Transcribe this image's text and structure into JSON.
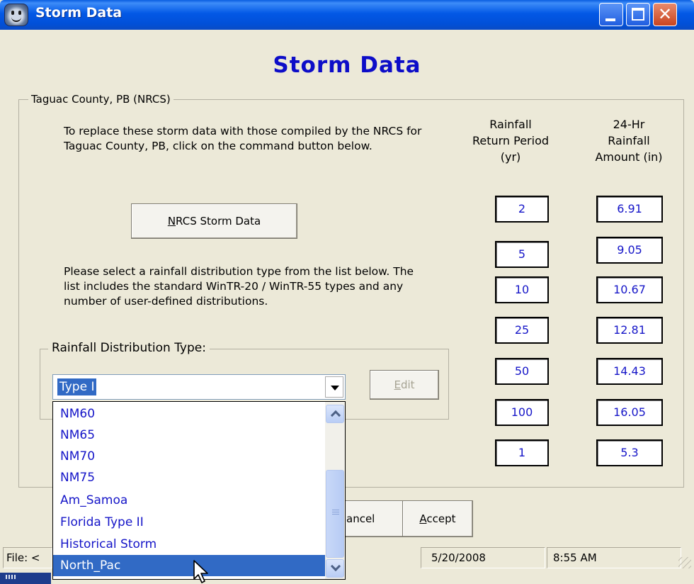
{
  "window": {
    "title": "Storm Data",
    "controls": [
      "minimize",
      "maximize",
      "close"
    ]
  },
  "heading": "Storm Data",
  "county_group": {
    "legend": "Taguac County, PB  (NRCS)",
    "instructions": "To replace these storm data with those compiled by the NRCS for Taguac County, PB, click on the command button below.",
    "nrcs_button": {
      "mnemonic": "N",
      "rest": "RCS Storm Data"
    },
    "distribution_instructions": "Please select a rainfall distribution type from the list below. The list includes the standard WinTR-20 / WinTR-55 types and any number of user-defined distributions."
  },
  "distribution": {
    "legend": "Rainfall Distribution Type:",
    "selected": "Type I",
    "edit_button": {
      "mnemonic": "E",
      "rest": "dit"
    },
    "options_visible": [
      "NM60",
      "NM65",
      "NM70",
      "NM75",
      "Am_Samoa",
      "Florida Type II",
      "Historical Storm",
      "North_Pac"
    ],
    "highlighted_option": "North_Pac",
    "scroll_position": 0.75
  },
  "table": {
    "period_header": [
      "Rainfall",
      "Return Period",
      "(yr)"
    ],
    "amount_header": [
      "24-Hr",
      "Rainfall",
      "Amount (in)"
    ],
    "rows": [
      {
        "period": "2",
        "amount": "6.91"
      },
      {
        "period": "5",
        "amount": "9.05"
      },
      {
        "period": "10",
        "amount": "10.67"
      },
      {
        "period": "25",
        "amount": "12.81"
      },
      {
        "period": "50",
        "amount": "14.43"
      },
      {
        "period": "100",
        "amount": "16.05"
      },
      {
        "period": "1",
        "amount": "5.3"
      }
    ]
  },
  "buttons": {
    "cancel_partial": "ancel",
    "accept": {
      "mnemonic": "A",
      "rest": "ccept"
    }
  },
  "status_bar": {
    "file_label": "File: <",
    "date": "5/20/2008",
    "time": "8:55 AM"
  },
  "colors": {
    "heading": "#0d0dc8",
    "value_text": "#1515c8",
    "selection": "#316ac5",
    "titlebar": "#0358e6"
  }
}
